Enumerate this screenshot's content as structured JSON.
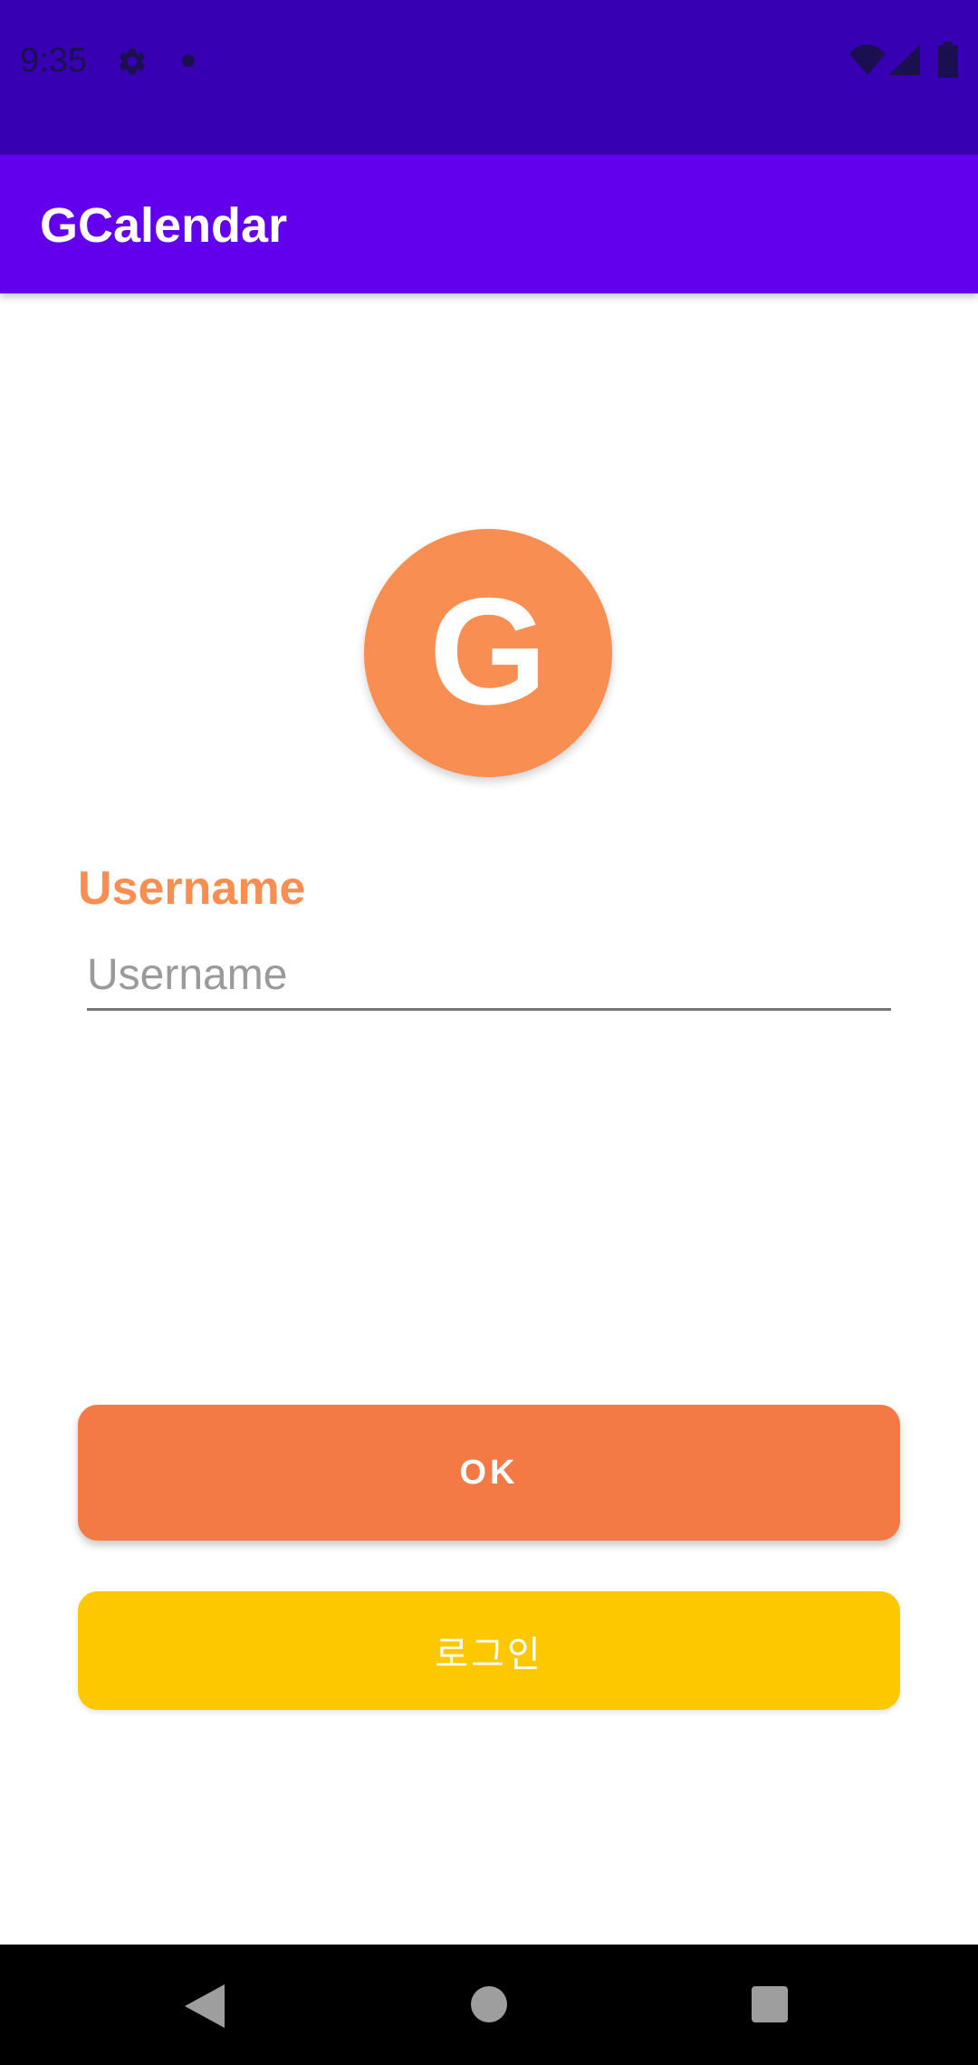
{
  "status_bar": {
    "time": "9:35",
    "icons": [
      "gear-icon",
      "notification-dot-icon",
      "wifi-icon",
      "signal-icon",
      "battery-icon"
    ]
  },
  "app_bar": {
    "title": "GCalendar"
  },
  "avatar": {
    "letter": "G"
  },
  "form": {
    "username_label": "Username",
    "username_placeholder": "Username",
    "username_value": ""
  },
  "buttons": {
    "ok_label": "OK",
    "login_label": "로그인"
  },
  "nav_bar": {
    "icons": [
      "back-icon",
      "home-icon",
      "recents-icon"
    ]
  },
  "colors": {
    "status_bar": "#3700b3",
    "app_bar": "#6200ee",
    "avatar": "#f88e51",
    "label": "#f88e51",
    "ok_button": "#f37a44",
    "login_button": "#fdc800"
  }
}
